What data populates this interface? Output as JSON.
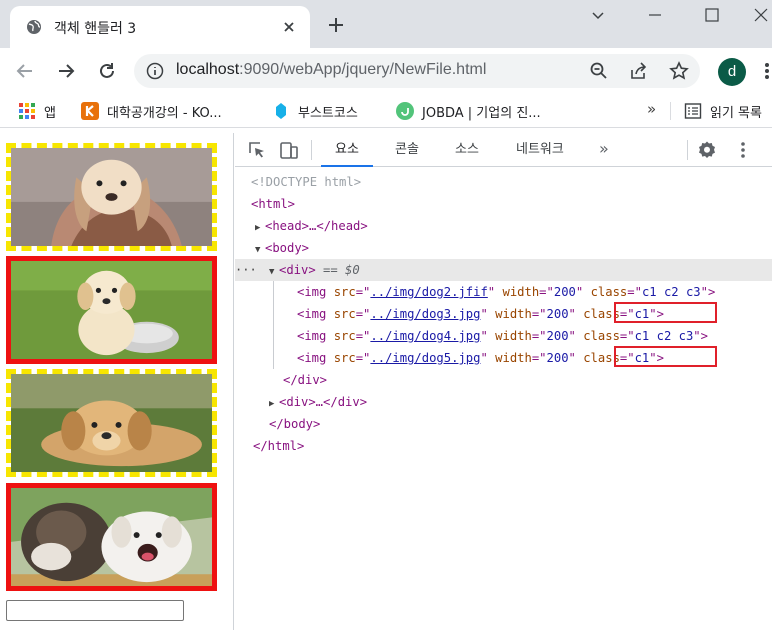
{
  "tab": {
    "title": "객체 핸들러 3"
  },
  "address": {
    "host": "localhost",
    "rest": ":9090/webApp/jquery/NewFile.html"
  },
  "profile": {
    "initial": "d"
  },
  "bookmarks": [
    {
      "label": "앱",
      "icon": "apps-grid-icon"
    },
    {
      "label": "대학공개강의 - KO...",
      "icon": "kocw-icon"
    },
    {
      "label": "부스트코스",
      "icon": "boostcourse-icon"
    },
    {
      "label": "JOBDA | 기업의 진...",
      "icon": "jobda-icon"
    }
  ],
  "bookmarks_more": "»",
  "reading_list": "읽기 목록",
  "devtools": {
    "tabs": [
      "요소",
      "콘솔",
      "소스",
      "네트워크"
    ],
    "more": "»",
    "dom": {
      "doctype": "<!DOCTYPE html>",
      "html_open": "<html>",
      "head": "<head>…</head>",
      "body_open": "<body>",
      "div_open": "<div>",
      "div_eq": "== $0",
      "images": [
        {
          "src": "../img/dog2.jfif",
          "width": "200",
          "class": "c1 c2 c3"
        },
        {
          "src": "../img/dog3.jpg",
          "width": "200",
          "class": "c1"
        },
        {
          "src": "../img/dog4.jpg",
          "width": "200",
          "class": "c1 c2 c3"
        },
        {
          "src": "../img/dog5.jpg",
          "width": "200",
          "class": "c1"
        }
      ],
      "div_close": "</div>",
      "div2": "<div>…</div>",
      "body_close": "</body>",
      "html_close": "</html>"
    }
  },
  "colors": {
    "yellow_dashed": "#f7e600",
    "red_solid": "#ee1111",
    "highlight_box": "#e0202a"
  }
}
